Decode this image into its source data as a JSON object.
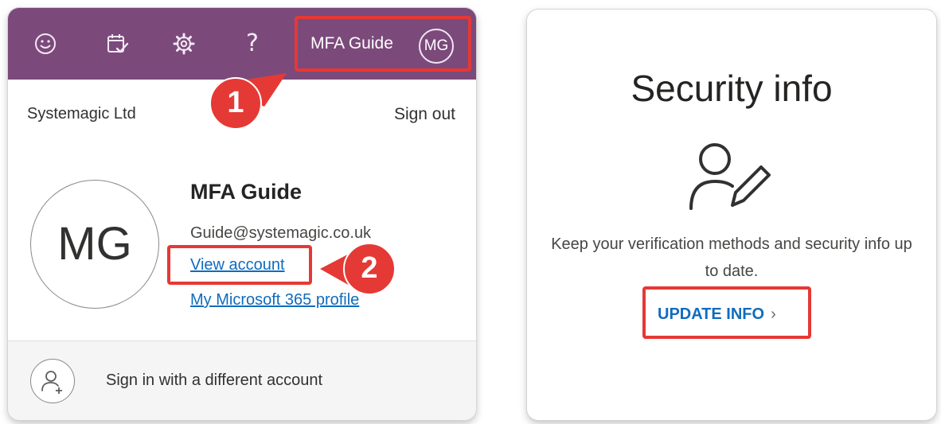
{
  "account_panel": {
    "topbar": {
      "background_color": "#7b4a7b",
      "icons": [
        "smiley-icon",
        "calendar-check-icon",
        "gear-icon",
        "help-icon"
      ],
      "help_glyph": "?",
      "user_name": "MFA Guide",
      "user_initials": "MG"
    },
    "organization": "Systemagic Ltd",
    "sign_out_label": "Sign out",
    "profile": {
      "initials": "MG",
      "name": "MFA Guide",
      "email": "Guide@systemagic.co.uk",
      "view_account_label": "View account",
      "m365_profile_label": "My Microsoft 365 profile"
    },
    "alternate_account_label": "Sign in with a different account"
  },
  "markers": [
    {
      "number": "1",
      "color": "#e53935"
    },
    {
      "number": "2",
      "color": "#e53935"
    }
  ],
  "security_panel": {
    "title": "Security info",
    "icon": "person-edit-icon",
    "description": "Keep your verification methods and security info up to date.",
    "update_label": "UPDATE INFO",
    "update_chevron": "›"
  },
  "colors": {
    "highlight": "#e53935",
    "link": "#0f6cbd"
  }
}
